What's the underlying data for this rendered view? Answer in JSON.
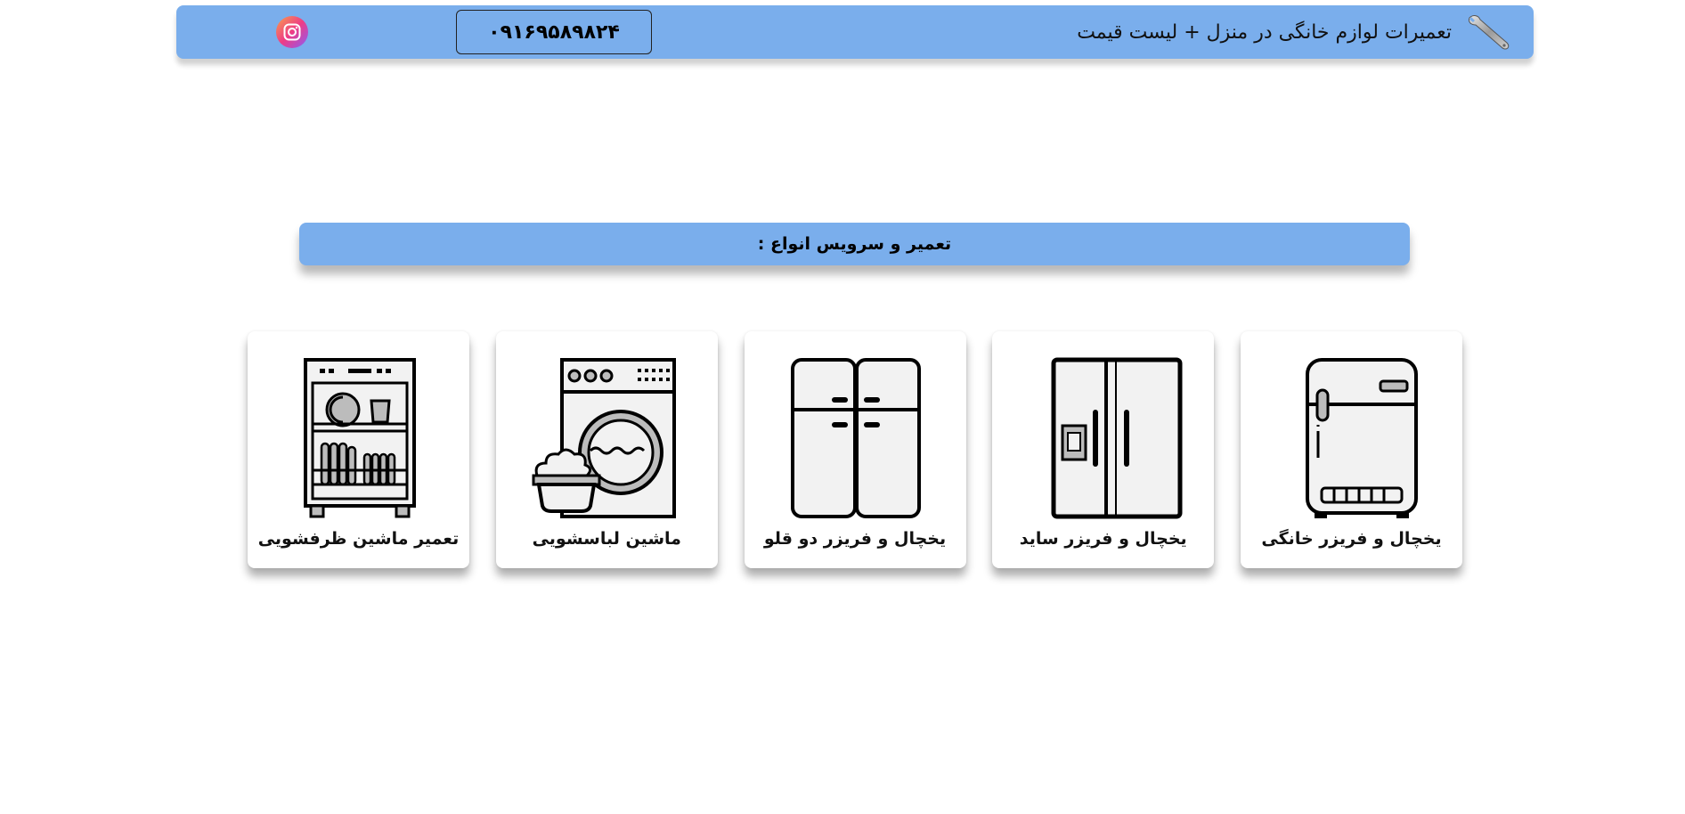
{
  "header": {
    "title": "تعمیرات لوازم خانگی در منزل + لیست قیمت",
    "phone": "۰۹۱۶۹۵۸۹۸۲۴",
    "logo_icon": "wrench-icon",
    "social_icon": "instagram-icon"
  },
  "section": {
    "title": "تعمیر و سرویس انواع :"
  },
  "services": [
    {
      "label": "یخچال و فریزر خانگی",
      "icon": "fridge-icon"
    },
    {
      "label": "یخچال و فریزر ساید",
      "icon": "side-by-side-fridge-icon"
    },
    {
      "label": "یخچال و فریزر دو قلو",
      "icon": "twin-fridge-icon"
    },
    {
      "label": "ماشین لباسشویی",
      "icon": "washing-machine-icon"
    },
    {
      "label": "تعمیر ماشین ظرفشویی",
      "icon": "dishwasher-icon"
    }
  ],
  "colors": {
    "bar_blue": "#7aaeec",
    "icon_fill": "#f2f2f2",
    "icon_stroke": "#000000"
  }
}
